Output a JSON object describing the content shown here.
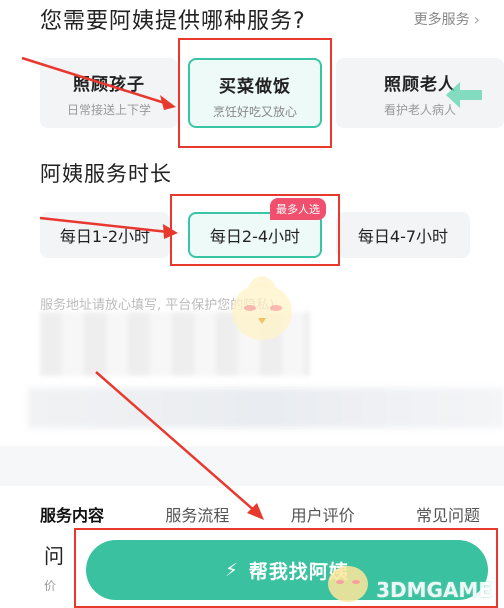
{
  "services": {
    "title": "您需要阿姨提供哪种服务?",
    "more_label": "更多服务",
    "items": [
      {
        "name": "照顾孩子",
        "desc": "日常接送上下学"
      },
      {
        "name": "买菜做饭",
        "desc": "烹饪好吃又放心"
      },
      {
        "name": "照顾老人",
        "desc": "看护老人病人"
      }
    ],
    "selected": 1
  },
  "duration": {
    "title": "阿姨服务时长",
    "items": [
      "每日1-2小时",
      "每日2-4小时",
      "每日4-7小时"
    ],
    "badge": "最多人选",
    "selected": 1
  },
  "privacy_note": "服务地址请放心填写, 平台保护您的隐私)",
  "tabs": [
    "服务内容",
    "服务流程",
    "用户评价",
    "常见问题"
  ],
  "footer": {
    "left_title": "问",
    "left_sub": "价",
    "cta_label": "帮我找阿姨"
  },
  "watermark": "3DMGAME",
  "colors": {
    "accent": "#3ac1a0",
    "annotation_red": "#e8392f",
    "badge": "#f0506e"
  }
}
